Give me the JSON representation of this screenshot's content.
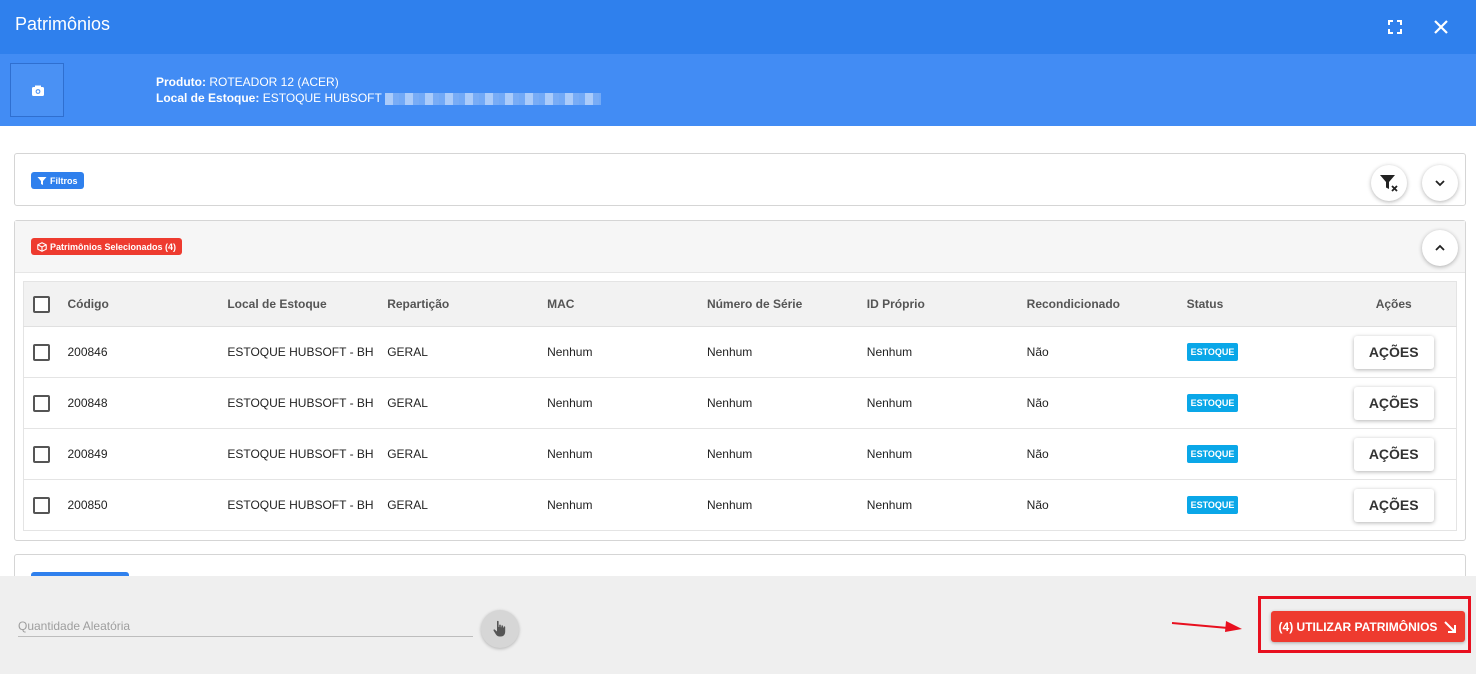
{
  "modal": {
    "title": "Patrimônios"
  },
  "product_info": {
    "produto_label": "Produto:",
    "produto_value": "ROTEADOR 12 (ACER)",
    "local_label": "Local de Estoque:",
    "local_value": "ESTOQUE HUBSOFT"
  },
  "filters": {
    "chip_label": "Filtros"
  },
  "selected": {
    "chip_label": "Patrimônios Selecionados (4)",
    "columns": [
      "Código",
      "Local de Estoque",
      "Repartição",
      "MAC",
      "Número de Série",
      "ID Próprio",
      "Recondicionado",
      "Status",
      "Ações"
    ],
    "rows": [
      {
        "codigo": "200846",
        "local": "ESTOQUE HUBSOFT - BH",
        "reparticao": "GERAL",
        "mac": "Nenhum",
        "serie": "Nenhum",
        "id_proprio": "Nenhum",
        "recondicionado": "Não",
        "status": "ESTOQUE",
        "acoes": "AÇÕES"
      },
      {
        "codigo": "200848",
        "local": "ESTOQUE HUBSOFT - BH",
        "reparticao": "GERAL",
        "mac": "Nenhum",
        "serie": "Nenhum",
        "id_proprio": "Nenhum",
        "recondicionado": "Não",
        "status": "ESTOQUE",
        "acoes": "AÇÕES"
      },
      {
        "codigo": "200849",
        "local": "ESTOQUE HUBSOFT - BH",
        "reparticao": "GERAL",
        "mac": "Nenhum",
        "serie": "Nenhum",
        "id_proprio": "Nenhum",
        "recondicionado": "Não",
        "status": "ESTOQUE",
        "acoes": "AÇÕES"
      },
      {
        "codigo": "200850",
        "local": "ESTOQUE HUBSOFT - BH",
        "reparticao": "GERAL",
        "mac": "Nenhum",
        "serie": "Nenhum",
        "id_proprio": "Nenhum",
        "recondicionado": "Não",
        "status": "ESTOQUE",
        "acoes": "AÇÕES"
      }
    ]
  },
  "footer": {
    "quantity_placeholder": "Quantidade Aleatória",
    "use_button_label": "(4) UTILIZAR PATRIMÔNIOS"
  },
  "colors": {
    "primary": "#2f80ed",
    "danger": "#ee3b2f",
    "status": "#0aa7e8",
    "highlight": "#e8101f"
  },
  "icons": [
    "fullscreen-icon",
    "close-icon",
    "camera-icon",
    "filter-icon",
    "clear-filter-icon",
    "chevron-down-icon",
    "chevron-up-icon",
    "cube-icon",
    "hand-pointer-icon",
    "arrow-down-right-icon"
  ]
}
